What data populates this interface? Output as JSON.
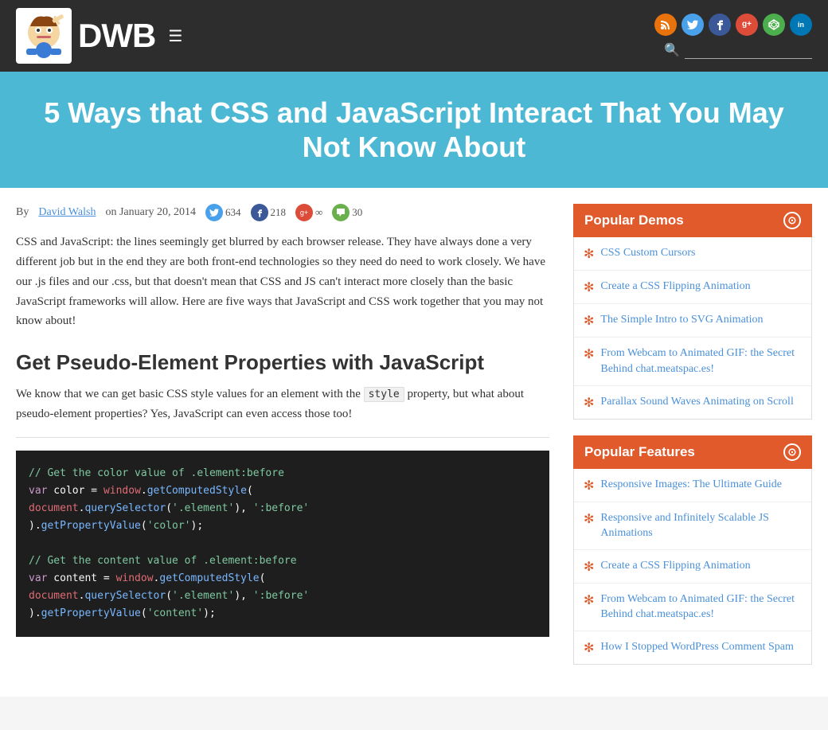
{
  "header": {
    "logo_text": "DWB",
    "menu_icon": "☰",
    "search_placeholder": "",
    "social": [
      {
        "name": "rss",
        "label": "rss",
        "class": "si-rss",
        "symbol": "◉"
      },
      {
        "name": "twitter",
        "label": "t",
        "class": "si-twitter",
        "symbol": "t"
      },
      {
        "name": "facebook",
        "label": "f",
        "class": "si-facebook",
        "symbol": "f"
      },
      {
        "name": "google",
        "label": "g+",
        "class": "si-google",
        "symbol": "g+"
      },
      {
        "name": "codepen",
        "label": "cp",
        "class": "si-codepen",
        "symbol": "○"
      },
      {
        "name": "linkedin",
        "label": "in",
        "class": "si-linkedin",
        "symbol": "in"
      }
    ]
  },
  "hero": {
    "title": "5 Ways that CSS and JavaScript Interact That You May Not Know About"
  },
  "article": {
    "by_label": "By",
    "author": "David Walsh",
    "date": "on January 20, 2014",
    "twitter_count": "634",
    "facebook_count": "218",
    "google_count": "∞",
    "comment_count": "30",
    "intro": "CSS and JavaScript:  the lines seemingly get blurred by each browser release.  They have always done a very different job but in the end they are both front-end technologies so they need do need to work closely.  We have our .js files and our .css, but that doesn't mean that CSS and JS can't interact more closely than the basic JavaScript frameworks will allow.  Here are five ways that JavaScript and CSS work together that you may not know about!",
    "section1_heading": "Get Pseudo-Element Properties with JavaScript",
    "section1_text1": "We know that we can get basic CSS style values for an element with the",
    "section1_inline_code": "style",
    "section1_text2": "property, but what about pseudo-element properties?  Yes, JavaScript can even access those too!",
    "code_lines": [
      {
        "type": "comment",
        "text": "// Get the color value of .element:before"
      },
      {
        "type": "code",
        "parts": [
          {
            "class": "c-keyword",
            "text": "var"
          },
          {
            "class": "c-plain",
            "text": " color = "
          },
          {
            "class": "c-obj",
            "text": "window"
          },
          {
            "class": "c-plain",
            "text": "."
          },
          {
            "class": "c-method",
            "text": "getComputedStyle"
          },
          {
            "class": "c-plain",
            "text": "("
          }
        ]
      },
      {
        "type": "code",
        "parts": [
          {
            "class": "c-obj",
            "text": "document"
          },
          {
            "class": "c-plain",
            "text": "."
          },
          {
            "class": "c-method",
            "text": "querySelector"
          },
          {
            "class": "c-plain",
            "text": "("
          },
          {
            "class": "c-string",
            "text": "'.element'"
          },
          {
            "class": "c-plain",
            "text": "), "
          },
          {
            "class": "c-string",
            "text": "':before'"
          }
        ]
      },
      {
        "type": "code",
        "parts": [
          {
            "class": "c-plain",
            "text": ")."
          },
          {
            "class": "c-method",
            "text": "getPropertyValue"
          },
          {
            "class": "c-plain",
            "text": "("
          },
          {
            "class": "c-string",
            "text": "'color'"
          },
          {
            "class": "c-plain",
            "text": ");"
          }
        ]
      },
      {
        "type": "empty"
      },
      {
        "type": "comment",
        "text": "// Get the content value of .element:before"
      },
      {
        "type": "code",
        "parts": [
          {
            "class": "c-keyword",
            "text": "var"
          },
          {
            "class": "c-plain",
            "text": " content = "
          },
          {
            "class": "c-obj",
            "text": "window"
          },
          {
            "class": "c-plain",
            "text": "."
          },
          {
            "class": "c-method",
            "text": "getComputedStyle"
          },
          {
            "class": "c-plain",
            "text": "("
          }
        ]
      },
      {
        "type": "code",
        "parts": [
          {
            "class": "c-obj",
            "text": "document"
          },
          {
            "class": "c-plain",
            "text": "."
          },
          {
            "class": "c-method",
            "text": "querySelector"
          },
          {
            "class": "c-plain",
            "text": "("
          },
          {
            "class": "c-string",
            "text": "'.element'"
          },
          {
            "class": "c-plain",
            "text": "), "
          },
          {
            "class": "c-string",
            "text": "':before'"
          }
        ]
      },
      {
        "type": "code",
        "parts": [
          {
            "class": "c-plain",
            "text": ")."
          },
          {
            "class": "c-method",
            "text": "getPropertyValue"
          },
          {
            "class": "c-plain",
            "text": "("
          },
          {
            "class": "c-string",
            "text": "'content'"
          },
          {
            "class": "c-plain",
            "text": ");"
          }
        ]
      }
    ]
  },
  "sidebar": {
    "popular_demos": {
      "title": "Popular Demos",
      "items": [
        {
          "text": "CSS Custom Cursors"
        },
        {
          "text": "Create a CSS Flipping Animation"
        },
        {
          "text": "The Simple Intro to SVG Animation"
        },
        {
          "text": "From Webcam to Animated GIF: the Secret Behind chat.meatspac.es!"
        },
        {
          "text": "Parallax Sound Waves Animating on Scroll"
        }
      ]
    },
    "popular_features": {
      "title": "Popular Features",
      "items": [
        {
          "text": "Responsive Images: The Ultimate Guide"
        },
        {
          "text": "Responsive and Infinitely Scalable JS Animations"
        },
        {
          "text": "Create a CSS Flipping Animation"
        },
        {
          "text": "From Webcam to Animated GIF: the Secret Behind chat.meatspac.es!"
        },
        {
          "text": "How I Stopped WordPress Comment Spam"
        }
      ]
    }
  }
}
